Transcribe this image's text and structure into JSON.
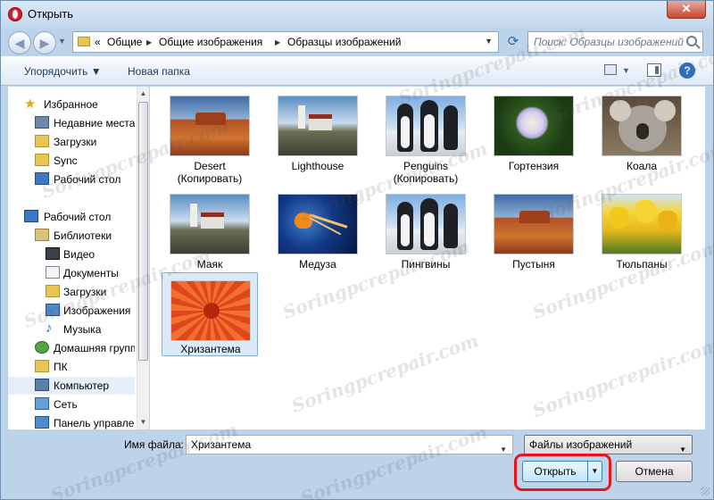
{
  "window": {
    "title": "Открыть",
    "close_glyph": "✕"
  },
  "nav": {
    "back_glyph": "◀",
    "forward_glyph": "▶",
    "address": {
      "overflow": "«",
      "crumbs": [
        "Общие",
        "Общие изображения",
        "Образцы изображений"
      ],
      "separator": "▶"
    },
    "search_placeholder": "Поиск: Образцы изображений"
  },
  "toolbar": {
    "organize_label": "Упорядочить ▼",
    "new_folder_label": "Новая папка",
    "help_glyph": "?"
  },
  "sidebar": {
    "items": [
      {
        "label": "Избранное",
        "icon": "star-icon"
      },
      {
        "label": "Недавние места",
        "icon": "recent-places-icon"
      },
      {
        "label": "Загрузки",
        "icon": "downloads-folder-icon"
      },
      {
        "label": "Sync",
        "icon": "folder-icon"
      },
      {
        "label": "Рабочий стол",
        "icon": "desktop-icon"
      },
      {
        "label": "Рабочий стол",
        "icon": "desktop-icon"
      },
      {
        "label": "Библиотеки",
        "icon": "libraries-icon"
      },
      {
        "label": "Видео",
        "icon": "video-icon"
      },
      {
        "label": "Документы",
        "icon": "documents-icon"
      },
      {
        "label": "Загрузки",
        "icon": "downloads-folder-icon"
      },
      {
        "label": "Изображения",
        "icon": "pictures-icon"
      },
      {
        "label": "Музыка",
        "icon": "music-icon"
      },
      {
        "label": "Домашняя группа",
        "icon": "homegroup-icon"
      },
      {
        "label": "ПК",
        "icon": "pc-folder-icon"
      },
      {
        "label": "Компьютер",
        "icon": "computer-icon"
      },
      {
        "label": "Сеть",
        "icon": "network-icon"
      },
      {
        "label": "Панель управления",
        "icon": "control-panel-icon"
      }
    ]
  },
  "files": [
    {
      "line1": "Desert",
      "line2": "(Копировать)",
      "image": "desert"
    },
    {
      "line1": "Lighthouse",
      "line2": "",
      "image": "lighthouse"
    },
    {
      "line1": "Penguins",
      "line2": "(Копировать)",
      "image": "penguins"
    },
    {
      "line1": "Гортензия",
      "line2": "",
      "image": "hydrangeas"
    },
    {
      "line1": "Коала",
      "line2": "",
      "image": "koala"
    },
    {
      "line1": "Маяк",
      "line2": "",
      "image": "lighthouse"
    },
    {
      "line1": "Медуза",
      "line2": "",
      "image": "jellyfish"
    },
    {
      "line1": "Пингвины",
      "line2": "",
      "image": "penguins"
    },
    {
      "line1": "Пустыня",
      "line2": "",
      "image": "desert"
    },
    {
      "line1": "Тюльпаны",
      "line2": "",
      "image": "tulips"
    },
    {
      "line1": "Хризантема",
      "line2": "",
      "image": "chrysanthemum",
      "selected": true
    }
  ],
  "footer": {
    "filename_label": "Имя файла:",
    "filename_value": "Хризантема",
    "filter_value": "Файлы изображений",
    "open_label": "Открыть",
    "cancel_label": "Отмена"
  },
  "watermark": "Soringpcrepair.com"
}
